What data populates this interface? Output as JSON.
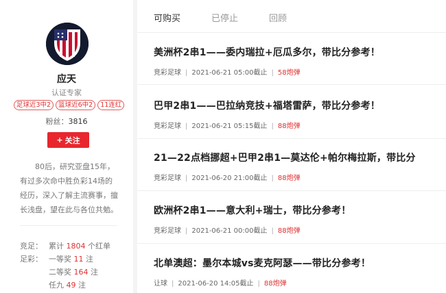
{
  "profile": {
    "name": "应天",
    "certification": "认证专家",
    "badges": [
      "足球近3中2",
      "篮球近6中2",
      "11连红"
    ],
    "fans_label": "粉丝：",
    "fans_count": "3816",
    "follow_label": "关注",
    "intro": "80后，研究亚盘15年，有过多次命中胜负彩14场的经历，深入了解主流赛事，擅长浅盘，望在此与各位共勉。",
    "stats": {
      "jingcai_label": "竞足：",
      "jingcai_prefix": "累计",
      "jingcai_count": "1804",
      "jingcai_suffix": "个红单",
      "zucai_label": "足彩：",
      "prizes": [
        {
          "label": "一等奖",
          "count": "11",
          "unit": "注"
        },
        {
          "label": "二等奖",
          "count": "164",
          "unit": "注"
        },
        {
          "label": "任九",
          "count": "49",
          "unit": "注"
        }
      ]
    }
  },
  "tabs": [
    {
      "label": "可购买",
      "active": true
    },
    {
      "label": "已停止",
      "active": false
    },
    {
      "label": "回顾",
      "active": false
    }
  ],
  "articles": [
    {
      "title": "美洲杯2串1——委内瑞拉+厄瓜多尔，带比分参考！",
      "category": "竞彩足球",
      "deadline": "2021-06-21 05:00截止",
      "price": "58炮弹"
    },
    {
      "title": "巴甲2串1——巴拉纳竞技+福塔雷萨，带比分参考！",
      "category": "竞彩足球",
      "deadline": "2021-06-21 05:15截止",
      "price": "88炮弹"
    },
    {
      "title": "21—22点档挪超+巴甲2串1—莫达伦+帕尔梅拉斯，带比分",
      "category": "竞彩足球",
      "deadline": "2021-06-20 21:00截止",
      "price": "88炮弹"
    },
    {
      "title": "欧洲杯2串1——意大利+瑞士，带比分参考！",
      "category": "竞彩足球",
      "deadline": "2021-06-21 00:00截止",
      "price": "88炮弹"
    },
    {
      "title": "北单澳超：墨尔本城vs麦克阿瑟——带比分参考！",
      "category": "让球",
      "deadline": "2021-06-20 14:05截止",
      "price": "88炮弹"
    }
  ]
}
